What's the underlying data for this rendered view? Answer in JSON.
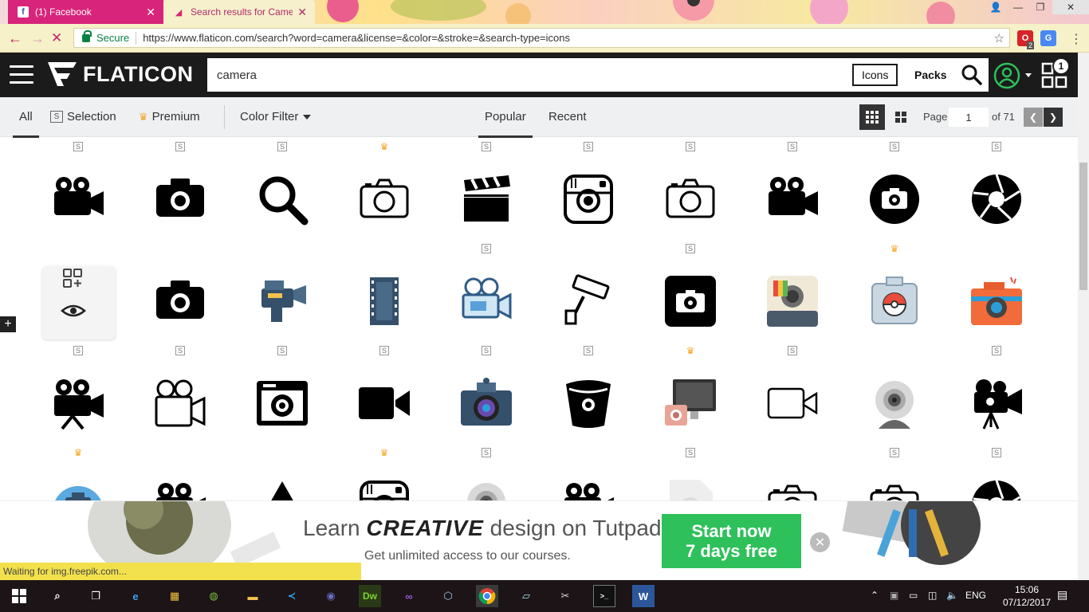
{
  "browser": {
    "tabs": [
      {
        "title": "(1) Facebook",
        "icon": "facebook-icon"
      },
      {
        "title": "Search results for Camera",
        "icon": "flaticon-favicon-icon"
      }
    ],
    "secure_label": "Secure",
    "url": "https://www.flaticon.com/search?word=camera&license=&color=&stroke=&search-type=icons",
    "extension_badge": "2"
  },
  "header": {
    "logo_text": "FLATICON",
    "search_value": "camera",
    "icons_button": "Icons",
    "packs_button": "Packs",
    "collection_count": "1"
  },
  "filters": {
    "all": "All",
    "selection": "Selection",
    "premium": "Premium",
    "color_filter": "Color Filter",
    "popular": "Popular",
    "recent": "Recent",
    "page_label": "Page",
    "page_value": "1",
    "page_total": "of 71"
  },
  "grid": {
    "selection_tag": "S",
    "rows": [
      [
        {
          "icon": "video-camera-icon",
          "tag": "S"
        },
        {
          "icon": "camera-icon",
          "tag": "S"
        },
        {
          "icon": "magnifier-icon",
          "tag": "S"
        },
        {
          "icon": "camera-outline-icon",
          "tag": "premium"
        },
        {
          "icon": "clapperboard-icon",
          "tag": "S"
        },
        {
          "icon": "instagram-icon",
          "tag": "S"
        },
        {
          "icon": "camera-outline-icon",
          "tag": "S"
        },
        {
          "icon": "video-camera-icon",
          "tag": "S"
        },
        {
          "icon": "camera-circle-icon",
          "tag": "S"
        },
        {
          "icon": "shutter-icon",
          "tag": "S"
        }
      ],
      [
        {
          "icon": "video-camera-hover-icon",
          "tag": ""
        },
        {
          "icon": "camera-icon",
          "tag": ""
        },
        {
          "icon": "camcorder-icon",
          "tag": ""
        },
        {
          "icon": "film-strip-icon",
          "tag": ""
        },
        {
          "icon": "video-camera-outline-icon",
          "tag": "S"
        },
        {
          "icon": "security-camera-icon",
          "tag": ""
        },
        {
          "icon": "camera-square-icon",
          "tag": "S"
        },
        {
          "icon": "polaroid-camera-icon",
          "tag": ""
        },
        {
          "icon": "pokeball-camera-icon",
          "tag": "premium"
        },
        {
          "icon": "orange-camera-icon",
          "tag": ""
        }
      ],
      [
        {
          "icon": "movie-camera-icon",
          "tag": "S"
        },
        {
          "icon": "movie-camera-outline-icon",
          "tag": "S"
        },
        {
          "icon": "retro-camera-icon",
          "tag": "S"
        },
        {
          "icon": "video-call-icon",
          "tag": "S"
        },
        {
          "icon": "photo-camera-color-icon",
          "tag": "S"
        },
        {
          "icon": "bitbucket-icon",
          "tag": "S"
        },
        {
          "icon": "monitor-camera-icon",
          "tag": "premium"
        },
        {
          "icon": "video-outline-icon",
          "tag": "S"
        },
        {
          "icon": "webcam-icon",
          "tag": ""
        },
        {
          "icon": "cinema-camera-icon",
          "tag": "S"
        }
      ],
      [
        {
          "icon": "camera-blue-icon",
          "tag": "premium"
        },
        {
          "icon": "video-camera-icon",
          "tag": ""
        },
        {
          "icon": "triangle-icon",
          "tag": ""
        },
        {
          "icon": "instagram-icon",
          "tag": "premium"
        },
        {
          "icon": "webcam-icon",
          "tag": "S"
        },
        {
          "icon": "video-camera-icon",
          "tag": ""
        },
        {
          "icon": "camera-file-icon",
          "tag": "S"
        },
        {
          "icon": "camera-outline-icon",
          "tag": ""
        },
        {
          "icon": "camera-outline-icon",
          "tag": "S"
        },
        {
          "icon": "shutter-icon",
          "tag": "S"
        }
      ]
    ]
  },
  "ad": {
    "headline_pre": "Learn ",
    "headline_em": "CREATIVE",
    "headline_post": " design on Tutpad",
    "subline": "Get unlimited access to our courses.",
    "cta_line1": "Start now",
    "cta_line2": "7 days free"
  },
  "status": "Waiting for img.freepik.com...",
  "taskbar": {
    "language": "ENG",
    "time": "15:06",
    "date": "07/12/2017"
  },
  "colors": {
    "header_bg": "#1b1b1b",
    "filter_bg": "#eef0f2",
    "cta_green": "#2ec05a",
    "premium_crown": "#f5a623",
    "secure_green": "#0b8043"
  }
}
